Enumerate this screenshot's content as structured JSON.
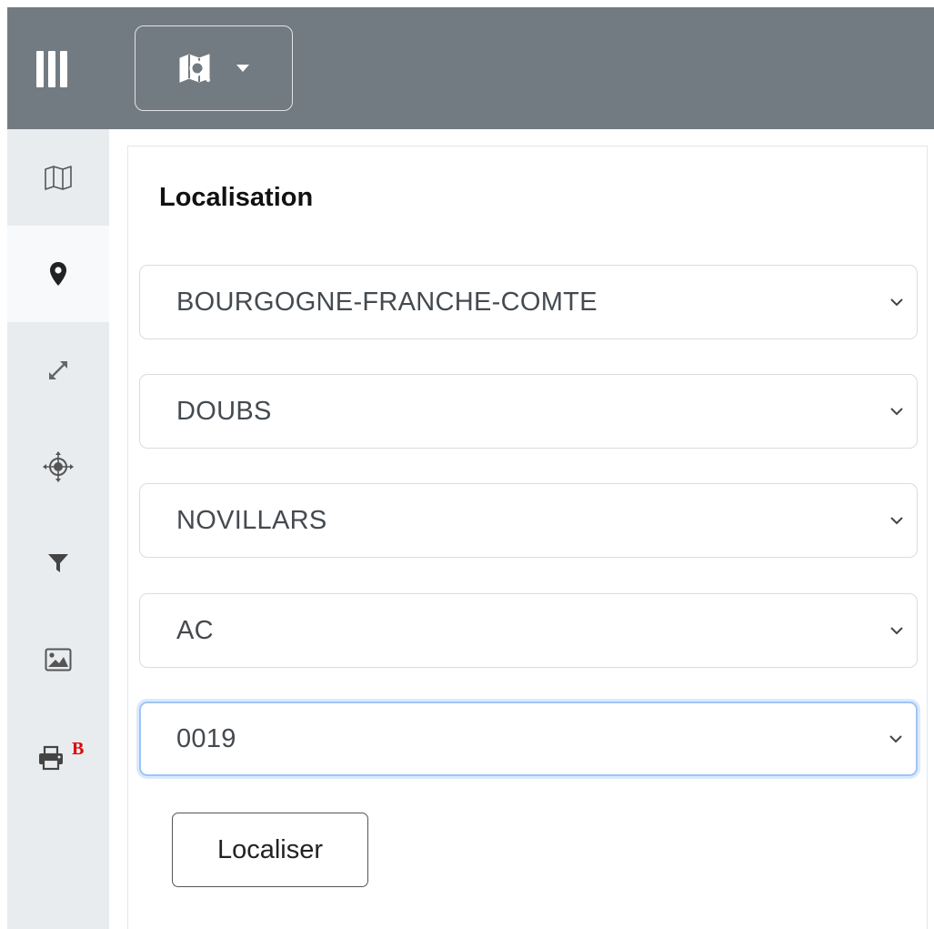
{
  "topbar": {
    "menu_icon": "columns-icon",
    "map_tool_icon": "map-search-icon",
    "dropdown_icon": "caret-down-icon"
  },
  "sidebar": {
    "items": [
      {
        "name": "map",
        "icon": "map-icon",
        "active": false
      },
      {
        "name": "location",
        "icon": "map-marker-icon",
        "active": true
      },
      {
        "name": "extent",
        "icon": "expand-arrows-icon",
        "active": false
      },
      {
        "name": "center",
        "icon": "crosshair-icon",
        "active": false
      },
      {
        "name": "filter",
        "icon": "filter-icon",
        "active": false
      },
      {
        "name": "image",
        "icon": "image-icon",
        "active": false
      },
      {
        "name": "print",
        "icon": "printer-icon",
        "active": false,
        "badge": "B",
        "badge_color": "#e00000"
      }
    ]
  },
  "panel": {
    "title": "Localisation",
    "selects": [
      {
        "value": "BOURGOGNE-FRANCHE-COMTE",
        "focused": false
      },
      {
        "value": "DOUBS",
        "focused": false
      },
      {
        "value": "NOVILLARS",
        "focused": false
      },
      {
        "value": "AC",
        "focused": false
      },
      {
        "value": "0019",
        "focused": true
      }
    ],
    "button_label": "Localiser"
  },
  "colors": {
    "topbar": "#737b82",
    "sidebar": "#e9ecef",
    "sidebar_active": "#f8f9fa",
    "focus_border": "#9ec5f3"
  }
}
